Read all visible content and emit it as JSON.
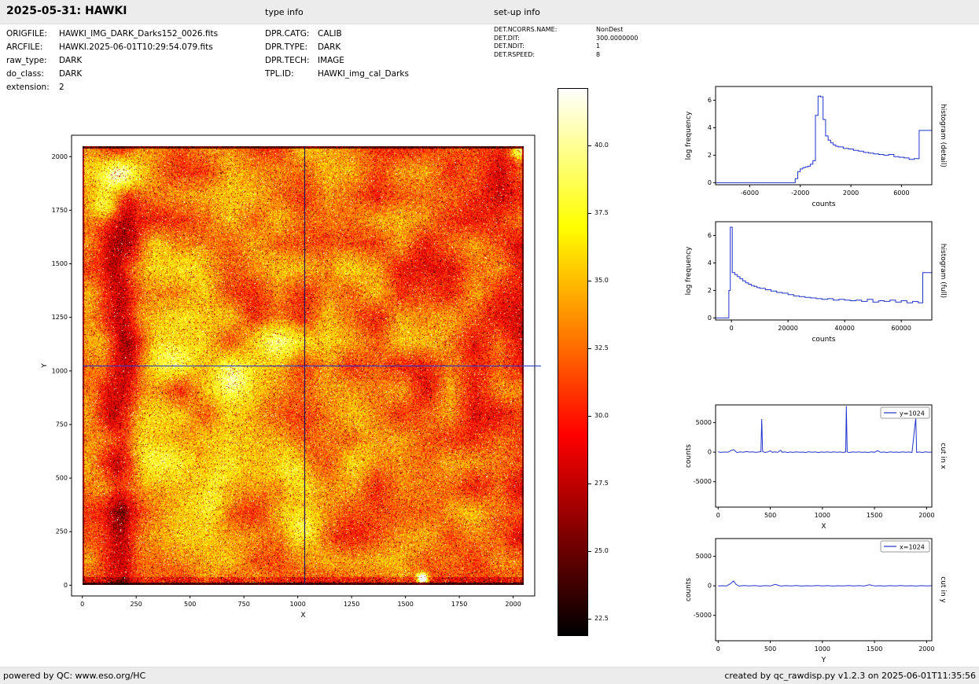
{
  "header": {
    "title": "2025-05-31: HAWKI",
    "type_info_label": "type info",
    "setup_info_label": "set-up info"
  },
  "metadata": {
    "file": [
      {
        "label": "ORIGFILE:",
        "value": "HAWKI_IMG_DARK_Darks152_0026.fits"
      },
      {
        "label": "ARCFILE:",
        "value": "HAWKI.2025-06-01T10:29:54.079.fits"
      },
      {
        "label": "raw_type:",
        "value": "DARK"
      },
      {
        "label": "do_class:",
        "value": "DARK"
      },
      {
        "label": "extension:",
        "value": "2"
      }
    ],
    "type": [
      {
        "label": "DPR.CATG:",
        "value": "CALIB"
      },
      {
        "label": "DPR.TYPE:",
        "value": "DARK"
      },
      {
        "label": "DPR.TECH:",
        "value": "IMAGE"
      },
      {
        "label": "TPL.ID:",
        "value": "HAWKI_img_cal_Darks"
      }
    ],
    "setup": [
      {
        "label": "DET.NCORRS.NAME:",
        "value": "NonDest"
      },
      {
        "label": "DET.DIT:",
        "value": "300.0000000"
      },
      {
        "label": "DET.NDIT:",
        "value": "1"
      },
      {
        "label": "DET.RSPEED:",
        "value": "8"
      }
    ]
  },
  "footer": {
    "left": "powered by QC: www.eso.org/HC",
    "right": "created by qc_rawdisp.py v1.2.3 on 2025-06-01T11:35:56"
  },
  "colors": {
    "accent_blue": "#2233cc",
    "dark_blue": "#1a1a66",
    "bar_background": "#ececec"
  },
  "chart_data": [
    {
      "name": "raw-image-display",
      "type": "heatmap",
      "xlabel": "X",
      "ylabel": "Y",
      "xlim": [
        -50,
        2100
      ],
      "ylim": [
        -50,
        2100
      ],
      "xticks": [
        0,
        250,
        500,
        750,
        1000,
        1250,
        1500,
        1750,
        2000
      ],
      "yticks": [
        0,
        250,
        500,
        750,
        1000,
        1250,
        1500,
        1750,
        2000
      ],
      "image_extent": [
        0,
        2048,
        0,
        2048
      ],
      "colormap": "hot",
      "colorbar": {
        "vmin": 21.9,
        "vmax": 42.1,
        "ticks": [
          22.5,
          25.0,
          27.5,
          30.0,
          32.5,
          35.0,
          37.5,
          40.0
        ]
      },
      "crosshair": {
        "x": 1024,
        "y": 1024
      },
      "features": {
        "dark_band_u": 0.088,
        "bright_regions": [
          [
            0.085,
            0.935,
            0.55,
            0.045
          ],
          [
            0.055,
            0.86,
            0.3,
            0.035
          ],
          [
            0.16,
            0.3,
            0.28,
            0.07
          ],
          [
            0.21,
            0.54,
            0.22,
            0.06
          ],
          [
            0.3,
            0.22,
            0.3,
            0.055
          ],
          [
            0.34,
            0.47,
            0.22,
            0.05
          ],
          [
            0.27,
            0.73,
            0.16,
            0.05
          ],
          [
            0.46,
            0.27,
            0.28,
            0.05
          ],
          [
            0.44,
            0.56,
            0.18,
            0.05
          ],
          [
            0.5,
            0.12,
            0.28,
            0.045
          ],
          [
            0.63,
            0.33,
            0.14,
            0.06
          ],
          [
            0.58,
            0.75,
            0.1,
            0.05
          ],
          [
            0.8,
            0.55,
            0.08,
            0.06
          ],
          [
            0.88,
            0.17,
            0.1,
            0.05
          ],
          [
            0.99,
            0.99,
            0.5,
            0.02
          ],
          [
            0.77,
            0.015,
            0.9,
            0.012
          ]
        ]
      }
    },
    {
      "name": "histogram-detail",
      "type": "line",
      "xlabel": "counts",
      "ylabel": "log frequency",
      "right_label": "histogram (detail)",
      "xlim": [
        -8700,
        8400
      ],
      "ylim": [
        -0.15,
        7
      ],
      "xticks": [
        -6000,
        -2000,
        2000,
        6000
      ],
      "yticks": [
        0,
        2,
        4,
        6
      ],
      "series": [
        {
          "name": "histogram",
          "style": "step",
          "points": [
            [
              -8700,
              0
            ],
            [
              -2600,
              0
            ],
            [
              -2400,
              0.3
            ],
            [
              -2200,
              0.8
            ],
            [
              -2000,
              1.0
            ],
            [
              -1800,
              1.1
            ],
            [
              -1600,
              1.15
            ],
            [
              -1400,
              1.2
            ],
            [
              -1200,
              1.35
            ],
            [
              -1000,
              1.6
            ],
            [
              -800,
              4.9
            ],
            [
              -600,
              6.3
            ],
            [
              -400,
              6.25
            ],
            [
              -200,
              4.6
            ],
            [
              0,
              3.4
            ],
            [
              200,
              3.1
            ],
            [
              400,
              2.9
            ],
            [
              600,
              2.75
            ],
            [
              800,
              2.65
            ],
            [
              1000,
              2.6
            ],
            [
              1400,
              2.5
            ],
            [
              1800,
              2.45
            ],
            [
              2200,
              2.35
            ],
            [
              2600,
              2.3
            ],
            [
              3000,
              2.2
            ],
            [
              3400,
              2.15
            ],
            [
              3800,
              2.1
            ],
            [
              4200,
              2.05
            ],
            [
              4600,
              2.0
            ],
            [
              5000,
              2.05
            ],
            [
              5400,
              1.9
            ],
            [
              5800,
              1.85
            ],
            [
              6200,
              1.8
            ],
            [
              6600,
              1.7
            ],
            [
              7000,
              1.75
            ],
            [
              7400,
              3.8
            ],
            [
              8400,
              3.8
            ]
          ]
        }
      ]
    },
    {
      "name": "histogram-full",
      "type": "line",
      "xlabel": "counts",
      "ylabel": "log frequency",
      "right_label": "histogram (full)",
      "xlim": [
        -5600,
        70800
      ],
      "ylim": [
        -0.15,
        7
      ],
      "xticks": [
        0,
        20000,
        40000,
        60000
      ],
      "yticks": [
        0,
        2,
        4,
        6
      ],
      "series": [
        {
          "name": "histogram",
          "style": "step",
          "points": [
            [
              -5600,
              0
            ],
            [
              -1400,
              0
            ],
            [
              -900,
              2.0
            ],
            [
              -400,
              6.6
            ],
            [
              300,
              3.3
            ],
            [
              1200,
              3.15
            ],
            [
              2100,
              3.0
            ],
            [
              3000,
              2.85
            ],
            [
              4000,
              2.7
            ],
            [
              5000,
              2.55
            ],
            [
              6000,
              2.45
            ],
            [
              7000,
              2.35
            ],
            [
              8000,
              2.3
            ],
            [
              9000,
              2.2
            ],
            [
              10000,
              2.15
            ],
            [
              12000,
              2.05
            ],
            [
              14000,
              1.95
            ],
            [
              16000,
              1.85
            ],
            [
              18000,
              1.8
            ],
            [
              20000,
              1.7
            ],
            [
              22000,
              1.6
            ],
            [
              24000,
              1.55
            ],
            [
              26000,
              1.5
            ],
            [
              28000,
              1.45
            ],
            [
              30000,
              1.4
            ],
            [
              32000,
              1.35
            ],
            [
              34000,
              1.4
            ],
            [
              36000,
              1.3
            ],
            [
              38000,
              1.35
            ],
            [
              40000,
              1.3
            ],
            [
              42000,
              1.25
            ],
            [
              44000,
              1.3
            ],
            [
              46000,
              1.2
            ],
            [
              48000,
              1.35
            ],
            [
              50000,
              1.15
            ],
            [
              52000,
              1.25
            ],
            [
              54000,
              1.2
            ],
            [
              56000,
              1.3
            ],
            [
              58000,
              1.15
            ],
            [
              60000,
              1.25
            ],
            [
              62000,
              1.1
            ],
            [
              64000,
              1.2
            ],
            [
              66000,
              1.1
            ],
            [
              67600,
              3.3
            ],
            [
              70800,
              3.3
            ]
          ]
        }
      ]
    },
    {
      "name": "cut-in-x",
      "type": "line",
      "xlabel": "X",
      "ylabel": "counts",
      "right_label": "cut in x",
      "legend": "y=1024",
      "xlim": [
        -25,
        2050
      ],
      "ylim": [
        -9300,
        8000
      ],
      "xticks": [
        0,
        500,
        1000,
        1500,
        2000
      ],
      "yticks": [
        5000,
        0,
        -5000
      ],
      "series": [
        {
          "name": "row-cut",
          "style": "line",
          "points": [
            [
              0,
              60
            ],
            [
              30,
              -40
            ],
            [
              60,
              30
            ],
            [
              90,
              -20
            ],
            [
              110,
              140
            ],
            [
              130,
              320
            ],
            [
              150,
              430
            ],
            [
              165,
              150
            ],
            [
              180,
              -60
            ],
            [
              210,
              40
            ],
            [
              240,
              -30
            ],
            [
              270,
              90
            ],
            [
              300,
              20
            ],
            [
              330,
              60
            ],
            [
              360,
              -40
            ],
            [
              390,
              30
            ],
            [
              410,
              90
            ],
            [
              418,
              5600
            ],
            [
              426,
              110
            ],
            [
              450,
              -60
            ],
            [
              475,
              40
            ],
            [
              500,
              230
            ],
            [
              520,
              -30
            ],
            [
              545,
              60
            ],
            [
              570,
              -40
            ],
            [
              600,
              320
            ],
            [
              615,
              -20
            ],
            [
              640,
              50
            ],
            [
              665,
              -70
            ],
            [
              690,
              30
            ],
            [
              720,
              -40
            ],
            [
              750,
              60
            ],
            [
              780,
              -30
            ],
            [
              810,
              20
            ],
            [
              840,
              -50
            ],
            [
              870,
              70
            ],
            [
              900,
              -20
            ],
            [
              930,
              40
            ],
            [
              960,
              -60
            ],
            [
              990,
              30
            ],
            [
              1020,
              -30
            ],
            [
              1050,
              50
            ],
            [
              1080,
              -40
            ],
            [
              1110,
              60
            ],
            [
              1140,
              -20
            ],
            [
              1170,
              30
            ],
            [
              1200,
              -50
            ],
            [
              1224,
              40
            ],
            [
              1230,
              7800
            ],
            [
              1238,
              30
            ],
            [
              1260,
              -60
            ],
            [
              1290,
              40
            ],
            [
              1320,
              -30
            ],
            [
              1350,
              50
            ],
            [
              1380,
              -40
            ],
            [
              1410,
              20
            ],
            [
              1440,
              -50
            ],
            [
              1470,
              60
            ],
            [
              1500,
              -30
            ],
            [
              1530,
              260
            ],
            [
              1560,
              -40
            ],
            [
              1590,
              30
            ],
            [
              1620,
              -60
            ],
            [
              1650,
              50
            ],
            [
              1680,
              -30
            ],
            [
              1710,
              20
            ],
            [
              1740,
              -40
            ],
            [
              1770,
              60
            ],
            [
              1800,
              -20
            ],
            [
              1830,
              30
            ],
            [
              1860,
              -50
            ],
            [
              1896,
              5800
            ],
            [
              1904,
              -40
            ],
            [
              1930,
              30
            ],
            [
              1960,
              -50
            ],
            [
              1990,
              40
            ],
            [
              2020,
              -30
            ],
            [
              2048,
              20
            ]
          ]
        }
      ]
    },
    {
      "name": "cut-in-y",
      "type": "line",
      "xlabel": "Y",
      "ylabel": "counts",
      "right_label": "cut in y",
      "legend": "x=1024",
      "xlim": [
        -25,
        2050
      ],
      "ylim": [
        -9300,
        8000
      ],
      "xticks": [
        0,
        500,
        1000,
        1500,
        2000
      ],
      "yticks": [
        5000,
        0,
        -5000
      ],
      "series": [
        {
          "name": "column-cut",
          "style": "line",
          "points": [
            [
              0,
              -30
            ],
            [
              40,
              20
            ],
            [
              80,
              -20
            ],
            [
              115,
              340
            ],
            [
              148,
              820
            ],
            [
              172,
              240
            ],
            [
              200,
              -40
            ],
            [
              250,
              60
            ],
            [
              300,
              -30
            ],
            [
              350,
              40
            ],
            [
              400,
              -50
            ],
            [
              450,
              30
            ],
            [
              500,
              -20
            ],
            [
              548,
              240
            ],
            [
              600,
              -40
            ],
            [
              650,
              30
            ],
            [
              700,
              -30
            ],
            [
              750,
              50
            ],
            [
              800,
              -40
            ],
            [
              850,
              20
            ],
            [
              900,
              -30
            ],
            [
              950,
              40
            ],
            [
              1000,
              -20
            ],
            [
              1050,
              30
            ],
            [
              1100,
              -40
            ],
            [
              1150,
              20
            ],
            [
              1200,
              -30
            ],
            [
              1250,
              40
            ],
            [
              1300,
              -20
            ],
            [
              1350,
              30
            ],
            [
              1400,
              -40
            ],
            [
              1452,
              180
            ],
            [
              1500,
              -30
            ],
            [
              1550,
              20
            ],
            [
              1600,
              -40
            ],
            [
              1650,
              30
            ],
            [
              1700,
              -20
            ],
            [
              1750,
              40
            ],
            [
              1800,
              -30
            ],
            [
              1850,
              20
            ],
            [
              1900,
              -40
            ],
            [
              1950,
              30
            ],
            [
              2000,
              -20
            ],
            [
              2048,
              10
            ]
          ]
        }
      ]
    }
  ]
}
